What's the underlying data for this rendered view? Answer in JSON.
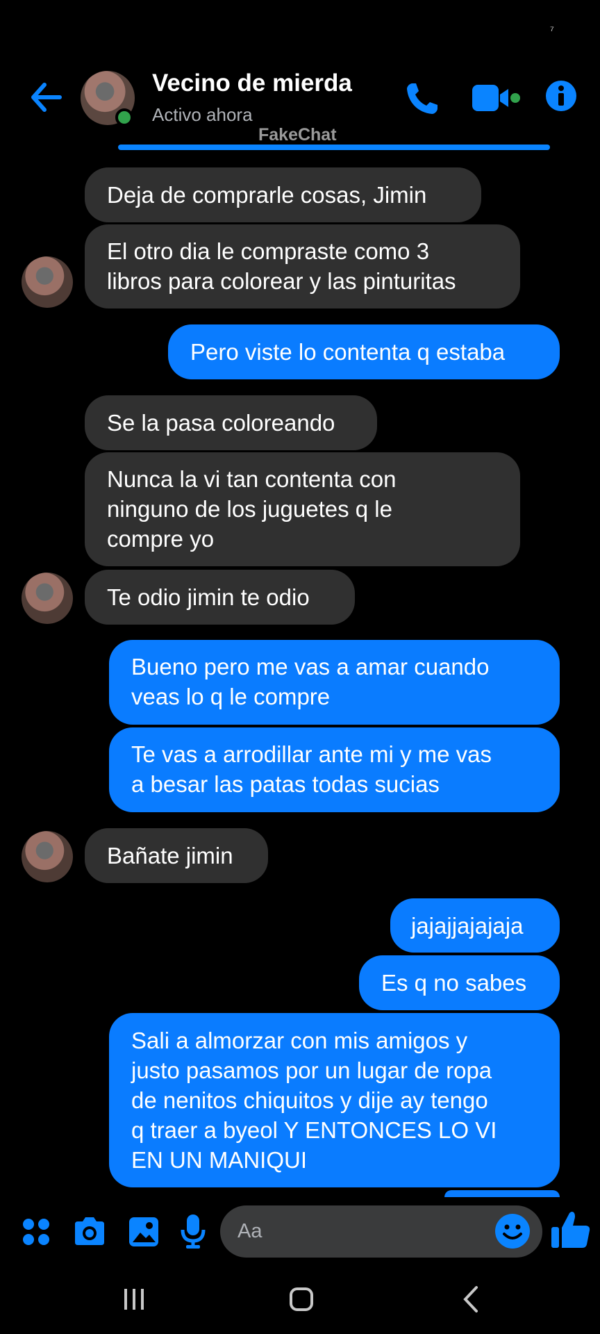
{
  "status": {
    "mark": "⁷"
  },
  "header": {
    "contact_name": "Vecino de mierda",
    "contact_status": "Activo ahora",
    "watermark": "FakeChat",
    "accent": "#0a84ff",
    "online_color": "#31a24c"
  },
  "messages": [
    {
      "side": "in",
      "lines": [
        "Deja de comprarle cosas, Jimin"
      ],
      "avatar": false
    },
    {
      "side": "in",
      "lines": [
        "El otro dia le compraste como 3",
        "libros para colorear y las pinturitas"
      ],
      "avatar": true
    },
    {
      "side": "out",
      "lines": [
        "Pero viste lo contenta q estaba"
      ]
    },
    {
      "side": "in",
      "lines": [
        "Se la pasa coloreando"
      ],
      "avatar": false
    },
    {
      "side": "in",
      "lines": [
        "Nunca la vi tan contenta con",
        "ninguno de los juguetes q le",
        "compre yo"
      ],
      "avatar": false
    },
    {
      "side": "in",
      "lines": [
        "Te odio jimin te odio"
      ],
      "avatar": true
    },
    {
      "side": "out",
      "lines": [
        "Bueno pero me vas a amar cuando",
        "veas lo q le compre"
      ]
    },
    {
      "side": "out",
      "lines": [
        "Te vas a arrodillar ante mi y me vas",
        "a besar las patas todas sucias"
      ]
    },
    {
      "side": "in",
      "lines": [
        "Bañate jimin"
      ],
      "avatar": true
    },
    {
      "side": "out",
      "lines": [
        "jajajjajajaja"
      ]
    },
    {
      "side": "out",
      "lines": [
        "Es q no sabes"
      ]
    },
    {
      "side": "out",
      "lines": [
        "Sali a almorzar con mis amigos y",
        "justo pasamos por un lugar de ropa",
        "de nenitos chiquitos y dije ay tengo",
        "q traer a byeol Y ENTONCES LO VI",
        "EN UN MANIQUI"
      ]
    }
  ],
  "composer": {
    "placeholder": "Aa",
    "icons": [
      "apps-icon",
      "camera-icon",
      "gallery-icon",
      "microphone-icon",
      "emoji-icon",
      "thumbs-up-icon"
    ]
  },
  "navbar": {
    "icons": [
      "recent-apps-icon",
      "home-icon",
      "back-nav-icon"
    ]
  },
  "colors": {
    "incoming_bubble": "#303030",
    "outgoing_bubble": "#0a7cff",
    "background": "#000000"
  }
}
